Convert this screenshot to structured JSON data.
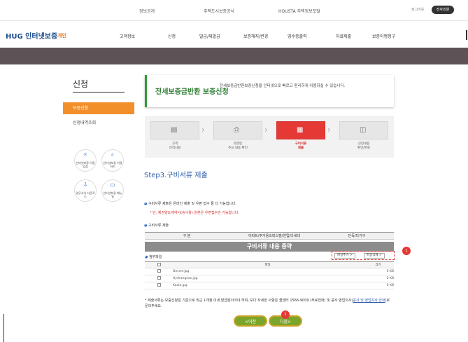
{
  "topbar": {
    "links": [
      "정보공개",
      "주택도시보증공사",
      "HOUSTA 주택정보포털"
    ],
    "login_label": "로그아웃",
    "join_label": "전자민원"
  },
  "header": {
    "logo_text": "HUG 인터넷보증",
    "logo_sub": "개인",
    "nav": [
      "고객정보",
      "신청",
      "발급/재발급",
      "보증해지/변경",
      "영수증출력",
      "자료제출",
      "보증이행청구"
    ]
  },
  "sidebar": {
    "title": "신청",
    "active_item": "보증신청",
    "item": "신청내역조회",
    "quick_links": [
      {
        "icon": "location-icon",
        "glyph": "⌾",
        "label": "인터넷보증 이용업점"
      },
      {
        "icon": "search-icon",
        "glyph": "⌕",
        "label": "인터넷보증 이용하기"
      },
      {
        "icon": "download-icon",
        "glyph": "⇩",
        "label": "업무서식 다운로드"
      },
      {
        "icon": "book-icon",
        "glyph": "▭",
        "label": "인터넷보증 매뉴얼"
      }
    ]
  },
  "banner": {
    "title": "전세보증금반환 보증신청",
    "desc": "전세보증금반환보증신청을 인터넷으로 빠르고 편리하게 이용하실 수 있습니다."
  },
  "steps": [
    {
      "label": "고객\n인적사항",
      "glyph": "▤",
      "active": false
    },
    {
      "label": "약관등\n주요 내용 확인",
      "glyph": "⎙",
      "active": false
    },
    {
      "label": "구비서류\n제출",
      "glyph": "▦",
      "active": true
    },
    {
      "label": "신청내용\n확인/완료",
      "glyph": "◫",
      "active": false
    }
  ],
  "step_heading": "Step3.구비서류 제출",
  "notice": {
    "line1": "구비서류 제출은 온라인 제출 및 우편 접수 둘 다 가능합니다.",
    "line2": "* 단, 채권양도계약서(승낙용) 원본은 우편접수만 가능합니다.",
    "line3": "구비서류 제출"
  },
  "doc_table": {
    "headers": [
      "구 분",
      "아파트/주거용오피스텔/연립/다세대",
      "단독/다가구"
    ]
  },
  "loading_text": "구비서류 내용 중략",
  "attach": {
    "label": "첨부파일",
    "add_button": "파일추가 >",
    "delete_button": "파일삭제 >",
    "badge1": "1",
    "headers": [
      "",
      "파일",
      "크기"
    ],
    "files": [
      {
        "name": "Desert.jpg",
        "size": "0 KB"
      },
      {
        "name": "Hydrangeas.jpg",
        "size": "0 KB"
      },
      {
        "name": "Koala.jpg",
        "size": "0 KB"
      }
    ]
  },
  "footnote": {
    "text": "* 제출서류는 보증신청일 기준으로 최근 1개월 이내 발급분이어야 하며, 보다 자세한 사항은 콜센터 1566-9009 (무료전화) 및 공사 영업지사(",
    "link": "공사 및 영업지사 안내",
    "tail": ")로 문의주세요."
  },
  "buttons": {
    "prev": "<이전",
    "next": "다음>",
    "badge2": "2"
  }
}
